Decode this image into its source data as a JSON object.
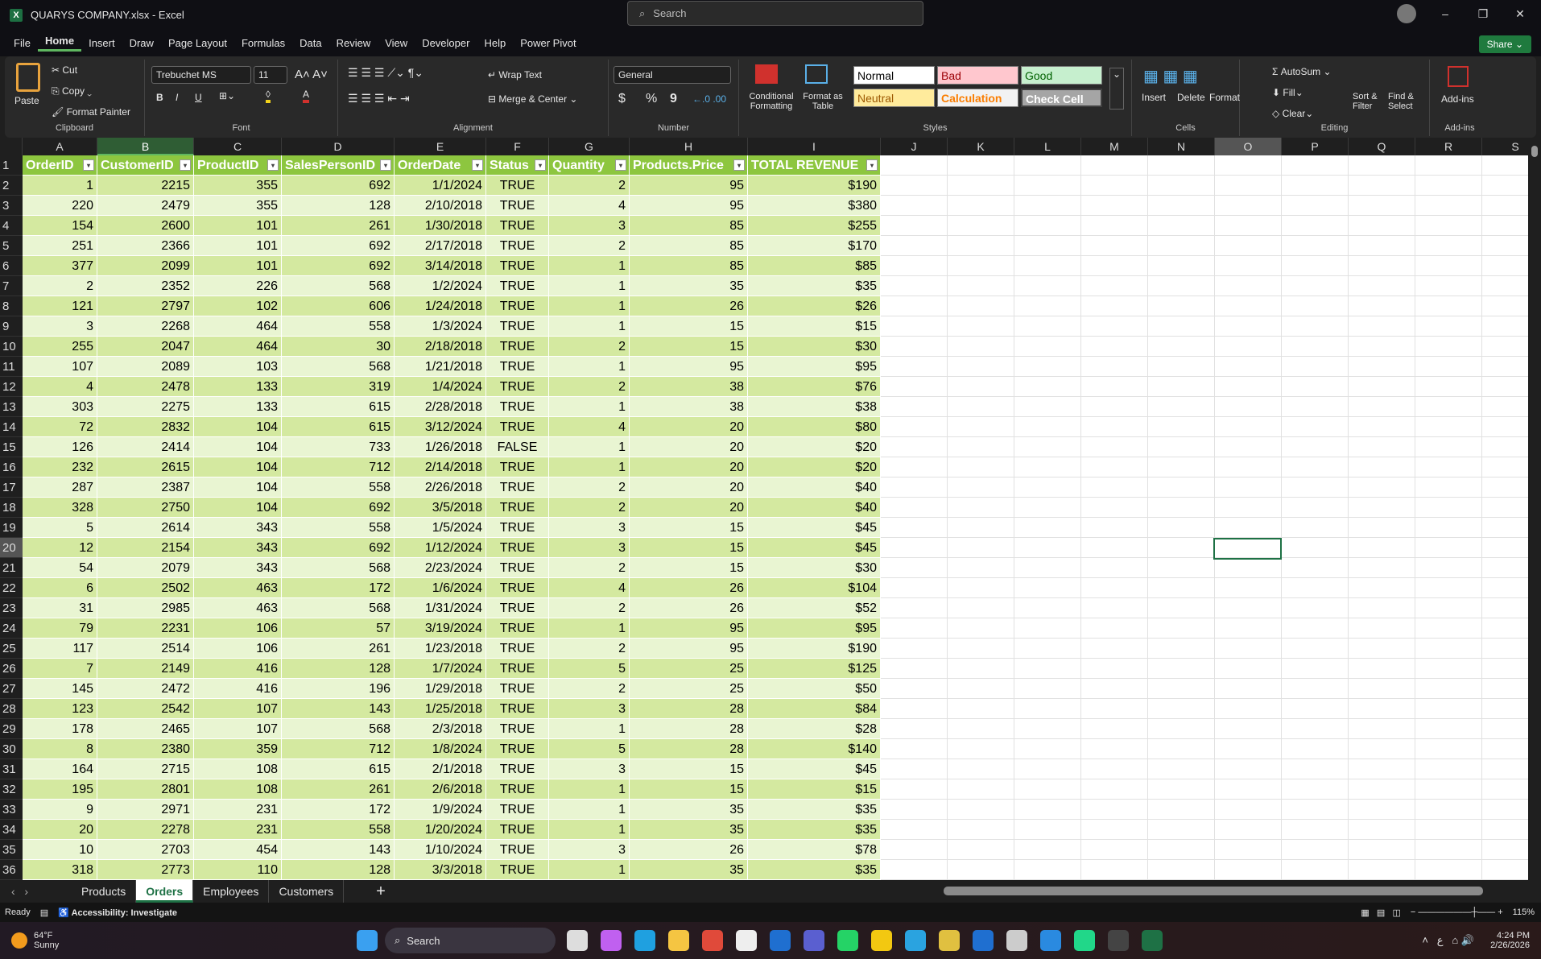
{
  "window": {
    "title": "QUARYS COMPANY.xlsx  -  Excel",
    "search_placeholder": "Search",
    "minimize": "–",
    "restore": "❐",
    "close": "✕"
  },
  "menu": {
    "items": [
      "File",
      "Home",
      "Insert",
      "Draw",
      "Page Layout",
      "Formulas",
      "Data",
      "Review",
      "View",
      "Developer",
      "Help",
      "Power Pivot"
    ],
    "active": "Home",
    "share": "Share"
  },
  "ribbon": {
    "clipboard": {
      "paste": "Paste",
      "cut": "Cut",
      "copy": "Copy",
      "format_painter": "Format Painter",
      "label": "Clipboard"
    },
    "font": {
      "name": "Trebuchet MS",
      "size": "11",
      "bold": "B",
      "italic": "I",
      "underline": "U",
      "label": "Font"
    },
    "alignment": {
      "wrap": "Wrap Text",
      "merge": "Merge & Center",
      "label": "Alignment"
    },
    "number": {
      "format": "General",
      "currency": "$",
      "percent": "%",
      "comma": "9",
      "label": "Number"
    },
    "styles": {
      "conditional": "Conditional Formatting",
      "format_table": "Format as Table",
      "normal": "Normal",
      "bad": "Bad",
      "good": "Good",
      "neutral": "Neutral",
      "calculation": "Calculation",
      "check": "Check Cell",
      "label": "Styles"
    },
    "cells": {
      "insert": "Insert",
      "delete": "Delete",
      "format": "Format",
      "label": "Cells"
    },
    "editing": {
      "autosum": "AutoSum",
      "fill": "Fill",
      "clear": "Clear",
      "sort": "Sort & Filter",
      "find": "Find & Select",
      "label": "Editing"
    },
    "addins": {
      "addins": "Add-ins",
      "label": "Add-ins"
    }
  },
  "columns": [
    "A",
    "B",
    "C",
    "D",
    "E",
    "F",
    "G",
    "H",
    "I",
    "J",
    "K",
    "L",
    "M",
    "N",
    "O",
    "P",
    "Q",
    "R",
    "S"
  ],
  "selected_column": "B",
  "active_cell": "O20",
  "table": {
    "headers": [
      "OrderID",
      "CustomerID",
      "ProductID",
      "SalesPersonID",
      "OrderDate",
      "Status",
      "Quantity",
      "Products.Price",
      "TOTAL REVENUE"
    ],
    "rows": [
      [
        "1",
        "2215",
        "355",
        "692",
        "1/1/2024",
        "TRUE",
        "2",
        "95",
        "$190"
      ],
      [
        "220",
        "2479",
        "355",
        "128",
        "2/10/2018",
        "TRUE",
        "4",
        "95",
        "$380"
      ],
      [
        "154",
        "2600",
        "101",
        "261",
        "1/30/2018",
        "TRUE",
        "3",
        "85",
        "$255"
      ],
      [
        "251",
        "2366",
        "101",
        "692",
        "2/17/2018",
        "TRUE",
        "2",
        "85",
        "$170"
      ],
      [
        "377",
        "2099",
        "101",
        "692",
        "3/14/2018",
        "TRUE",
        "1",
        "85",
        "$85"
      ],
      [
        "2",
        "2352",
        "226",
        "568",
        "1/2/2024",
        "TRUE",
        "1",
        "35",
        "$35"
      ],
      [
        "121",
        "2797",
        "102",
        "606",
        "1/24/2018",
        "TRUE",
        "1",
        "26",
        "$26"
      ],
      [
        "3",
        "2268",
        "464",
        "558",
        "1/3/2024",
        "TRUE",
        "1",
        "15",
        "$15"
      ],
      [
        "255",
        "2047",
        "464",
        "30",
        "2/18/2018",
        "TRUE",
        "2",
        "15",
        "$30"
      ],
      [
        "107",
        "2089",
        "103",
        "568",
        "1/21/2018",
        "TRUE",
        "1",
        "95",
        "$95"
      ],
      [
        "4",
        "2478",
        "133",
        "319",
        "1/4/2024",
        "TRUE",
        "2",
        "38",
        "$76"
      ],
      [
        "303",
        "2275",
        "133",
        "615",
        "2/28/2018",
        "TRUE",
        "1",
        "38",
        "$38"
      ],
      [
        "72",
        "2832",
        "104",
        "615",
        "3/12/2024",
        "TRUE",
        "4",
        "20",
        "$80"
      ],
      [
        "126",
        "2414",
        "104",
        "733",
        "1/26/2018",
        "FALSE",
        "1",
        "20",
        "$20"
      ],
      [
        "232",
        "2615",
        "104",
        "712",
        "2/14/2018",
        "TRUE",
        "1",
        "20",
        "$20"
      ],
      [
        "287",
        "2387",
        "104",
        "558",
        "2/26/2018",
        "TRUE",
        "2",
        "20",
        "$40"
      ],
      [
        "328",
        "2750",
        "104",
        "692",
        "3/5/2018",
        "TRUE",
        "2",
        "20",
        "$40"
      ],
      [
        "5",
        "2614",
        "343",
        "558",
        "1/5/2024",
        "TRUE",
        "3",
        "15",
        "$45"
      ],
      [
        "12",
        "2154",
        "343",
        "692",
        "1/12/2024",
        "TRUE",
        "3",
        "15",
        "$45"
      ],
      [
        "54",
        "2079",
        "343",
        "568",
        "2/23/2024",
        "TRUE",
        "2",
        "15",
        "$30"
      ],
      [
        "6",
        "2502",
        "463",
        "172",
        "1/6/2024",
        "TRUE",
        "4",
        "26",
        "$104"
      ],
      [
        "31",
        "2985",
        "463",
        "568",
        "1/31/2024",
        "TRUE",
        "2",
        "26",
        "$52"
      ],
      [
        "79",
        "2231",
        "106",
        "57",
        "3/19/2024",
        "TRUE",
        "1",
        "95",
        "$95"
      ],
      [
        "117",
        "2514",
        "106",
        "261",
        "1/23/2018",
        "TRUE",
        "2",
        "95",
        "$190"
      ],
      [
        "7",
        "2149",
        "416",
        "128",
        "1/7/2024",
        "TRUE",
        "5",
        "25",
        "$125"
      ],
      [
        "145",
        "2472",
        "416",
        "196",
        "1/29/2018",
        "TRUE",
        "2",
        "25",
        "$50"
      ],
      [
        "123",
        "2542",
        "107",
        "143",
        "1/25/2018",
        "TRUE",
        "3",
        "28",
        "$84"
      ],
      [
        "178",
        "2465",
        "107",
        "568",
        "2/3/2018",
        "TRUE",
        "1",
        "28",
        "$28"
      ],
      [
        "8",
        "2380",
        "359",
        "712",
        "1/8/2024",
        "TRUE",
        "5",
        "28",
        "$140"
      ],
      [
        "164",
        "2715",
        "108",
        "615",
        "2/1/2018",
        "TRUE",
        "3",
        "15",
        "$45"
      ],
      [
        "195",
        "2801",
        "108",
        "261",
        "2/6/2018",
        "TRUE",
        "1",
        "15",
        "$15"
      ],
      [
        "9",
        "2971",
        "231",
        "172",
        "1/9/2024",
        "TRUE",
        "1",
        "35",
        "$35"
      ],
      [
        "20",
        "2278",
        "231",
        "558",
        "1/20/2024",
        "TRUE",
        "1",
        "35",
        "$35"
      ],
      [
        "10",
        "2703",
        "454",
        "143",
        "1/10/2024",
        "TRUE",
        "3",
        "26",
        "$78"
      ],
      [
        "318",
        "2773",
        "110",
        "128",
        "3/3/2018",
        "TRUE",
        "1",
        "35",
        "$35"
      ]
    ]
  },
  "sheets": {
    "tabs": [
      "Products",
      "Orders",
      "Employees",
      "Customers"
    ],
    "active": "Orders",
    "add": "+"
  },
  "status": {
    "ready": "Ready",
    "accessibility": "Accessibility: Investigate",
    "zoom": "115%"
  },
  "taskbar": {
    "weather_temp": "64°F",
    "weather_desc": "Sunny",
    "search": "Search",
    "time": "4:24 PM",
    "date": "2/26/2026",
    "lang": "ع"
  },
  "colors": {
    "header_green": "#8dc63f",
    "band_dark": "#d4e9a0",
    "band_light": "#e9f5d2",
    "excel_green": "#1e7145"
  }
}
